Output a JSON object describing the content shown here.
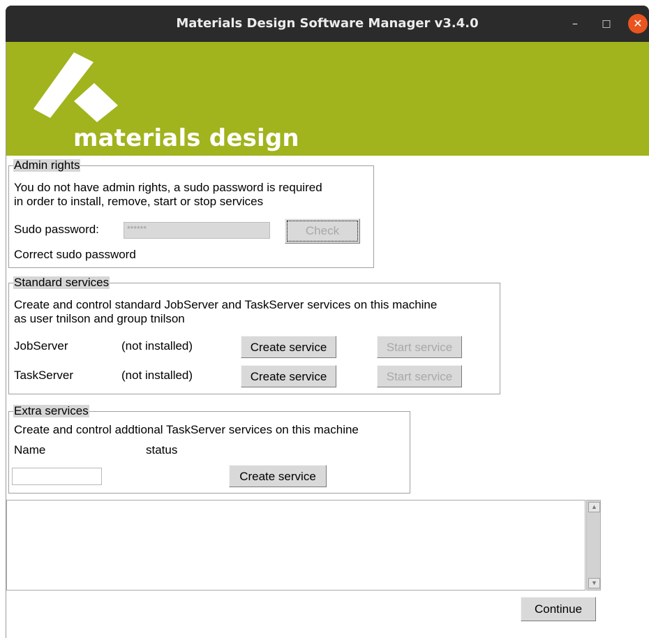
{
  "window": {
    "title": "Materials Design Software Manager v3.4.0",
    "minimize_icon": "minimize-icon",
    "maximize_icon": "maximize-icon",
    "close_icon": "close-icon"
  },
  "banner": {
    "logo_text": "materials design",
    "color": "#a1b31d"
  },
  "admin": {
    "legend": "Admin rights",
    "message_line1": "You do not have admin rights, a sudo password is required",
    "message_line2": "in order to install, remove, start or stop services",
    "password_label": "Sudo password:",
    "password_value": "******",
    "check_label": "Check",
    "status": "Correct sudo password"
  },
  "standard": {
    "legend": "Standard services",
    "desc_line1": "Create and control standard JobServer and TaskServer services on this machine",
    "desc_line2": "as user tnilson and group tnilson",
    "rows": [
      {
        "name": "JobServer",
        "status": "(not installed)",
        "create_label": "Create service",
        "start_label": "Start service"
      },
      {
        "name": "TaskServer",
        "status": "(not installed)",
        "create_label": "Create service",
        "start_label": "Start service"
      }
    ]
  },
  "extra": {
    "legend": "Extra services",
    "desc": "Create and control addtional TaskServer services on this machine",
    "name_header": "Name",
    "status_header": "status",
    "name_value": "",
    "create_label": "Create service"
  },
  "footer": {
    "continue_label": "Continue"
  }
}
